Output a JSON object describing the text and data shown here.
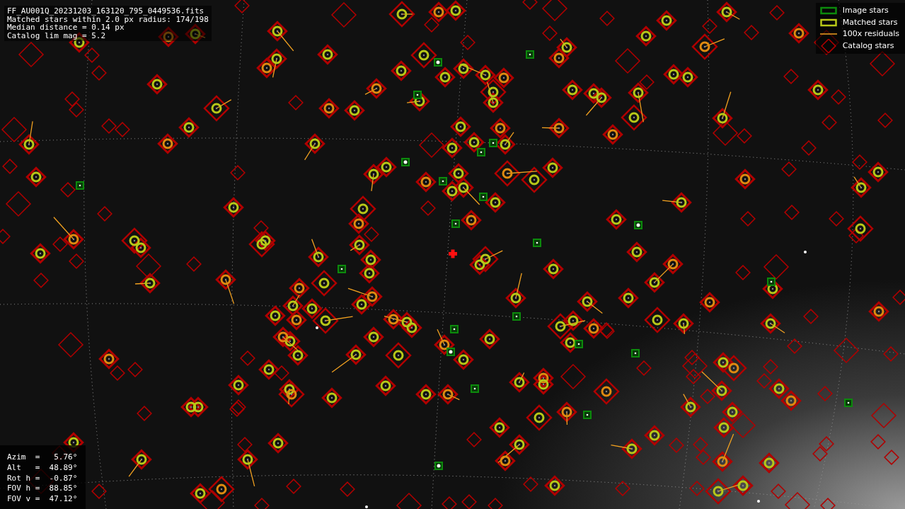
{
  "info_lines": [
    "FF_AU001Q_20231203_163120_795_0449536.fits",
    "Matched stars within 2.0 px radius: 174/198",
    "Median distance = 0.14 px",
    "Catalog lim mag = 5.2"
  ],
  "legend": [
    {
      "kind": "image",
      "label": "Image stars"
    },
    {
      "kind": "matched",
      "label": "Matched stars"
    },
    {
      "kind": "residual",
      "label": "100x residuals"
    },
    {
      "kind": "catalog",
      "label": "Catalog stars"
    }
  ],
  "pointing_lines": [
    "Azim  =   5.76°",
    "Alt   =  48.89°",
    "Rot h =  -0.87°",
    "FOV h =  88.85°",
    "FOV v =  47.12°"
  ]
}
